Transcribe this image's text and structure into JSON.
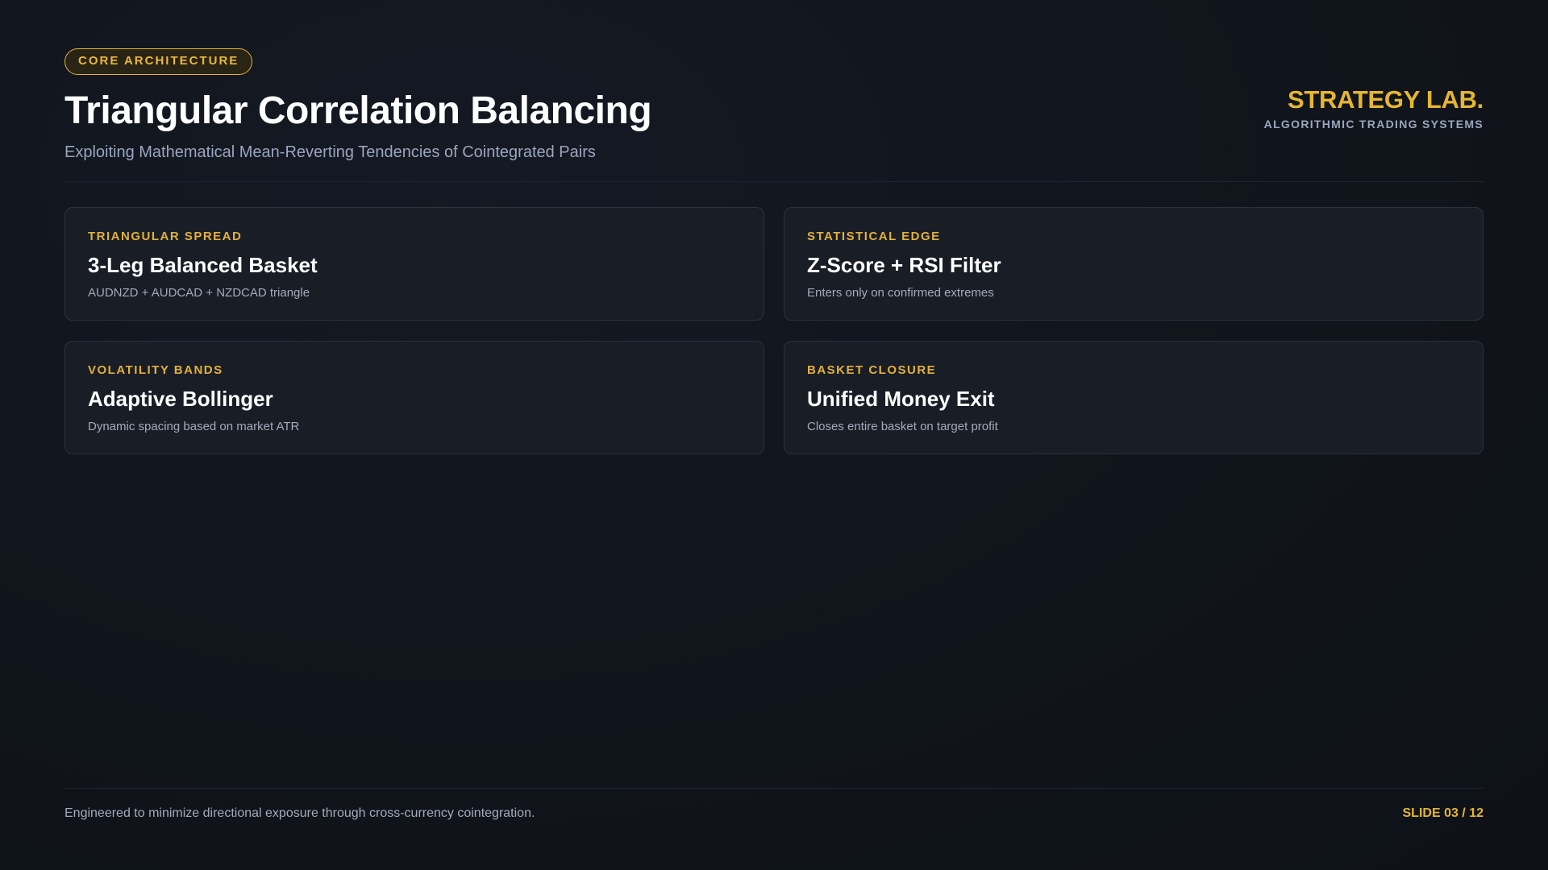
{
  "header": {
    "badge": "CORE ARCHITECTURE",
    "title": "Triangular Correlation Balancing",
    "subtitle": "Exploiting Mathematical Mean-Reverting Tendencies of Cointegrated Pairs"
  },
  "brand": {
    "name": "STRATEGY LAB.",
    "tagline": "ALGORITHMIC TRADING SYSTEMS"
  },
  "cards": [
    {
      "label": "TRIANGULAR SPREAD",
      "title": "3-Leg Balanced Basket",
      "description": "AUDNZD + AUDCAD + NZDCAD triangle"
    },
    {
      "label": "STATISTICAL EDGE",
      "title": "Z-Score + RSI Filter",
      "description": "Enters only on confirmed extremes"
    },
    {
      "label": "VOLATILITY BANDS",
      "title": "Adaptive Bollinger",
      "description": "Dynamic spacing based on market ATR"
    },
    {
      "label": "BASKET CLOSURE",
      "title": "Unified Money Exit",
      "description": "Closes entire basket on target profit"
    }
  ],
  "footer": {
    "text": "Engineered to minimize directional exposure through cross-currency cointegration.",
    "slide_number": "SLIDE 03 / 12"
  },
  "colors": {
    "background": "#11151d",
    "accent": "#e6b532",
    "card_background": "#191d26",
    "muted_text": "#9aa6bd"
  }
}
